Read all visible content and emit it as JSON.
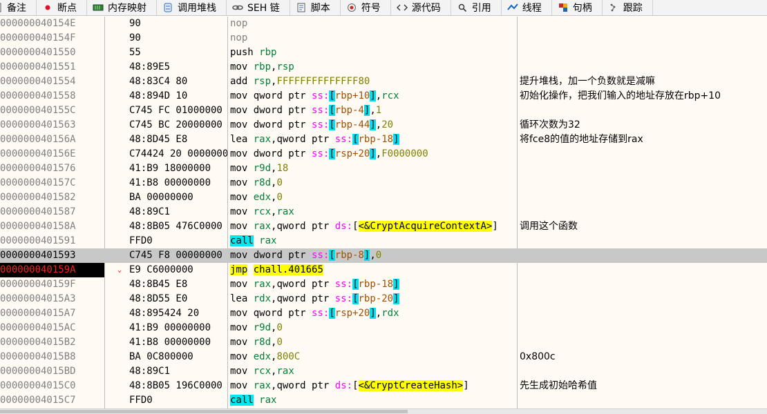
{
  "tabs": [
    {
      "label": "备注",
      "icon": "note-icon"
    },
    {
      "label": "断点",
      "icon": "breakpoint-icon"
    },
    {
      "label": "内存映射",
      "icon": "memory-map-icon"
    },
    {
      "label": "调用堆栈",
      "icon": "call-stack-icon"
    },
    {
      "label": "SEH 链",
      "icon": "seh-chain-icon"
    },
    {
      "label": "脚本",
      "icon": "script-icon"
    },
    {
      "label": "符号",
      "icon": "symbols-icon"
    },
    {
      "label": "源代码",
      "icon": "source-icon"
    },
    {
      "label": "引用",
      "icon": "references-icon"
    },
    {
      "label": "线程",
      "icon": "threads-icon"
    },
    {
      "label": "句柄",
      "icon": "handles-icon"
    },
    {
      "label": "跟踪",
      "icon": "trace-icon"
    }
  ],
  "rows": [
    {
      "addr": "000000040154E",
      "bytes": "90",
      "comment": ""
    },
    {
      "addr": "000000040154F",
      "bytes": "90",
      "comment": ""
    },
    {
      "addr": "0000000401550",
      "bytes": "55",
      "comment": ""
    },
    {
      "addr": "0000000401551",
      "bytes": "48:89E5",
      "comment": ""
    },
    {
      "addr": "0000000401554",
      "bytes": "48:83C4 80",
      "comment": "提升堆栈，加一个负数就是减嘛"
    },
    {
      "addr": "0000000401558",
      "bytes": "48:894D 10",
      "comment": "初始化操作，把我们输入的地址存放在rbp+10"
    },
    {
      "addr": "000000040155C",
      "bytes": "C745 FC 01000000",
      "comment": ""
    },
    {
      "addr": "0000000401563",
      "bytes": "C745 BC 20000000",
      "comment": "循环次数为32"
    },
    {
      "addr": "000000040156A",
      "bytes": "48:8D45 E8",
      "comment": "将fce8的值的地址存储到rax"
    },
    {
      "addr": "000000040156E",
      "bytes": "C74424 20 0000000F",
      "comment": ""
    },
    {
      "addr": "0000000401576",
      "bytes": "41:B9 18000000",
      "comment": ""
    },
    {
      "addr": "000000040157C",
      "bytes": "41:B8 00000000",
      "comment": ""
    },
    {
      "addr": "0000000401582",
      "bytes": "BA 00000000",
      "comment": ""
    },
    {
      "addr": "0000000401587",
      "bytes": "48:89C1",
      "comment": ""
    },
    {
      "addr": "000000040158A",
      "bytes": "48:8B05 476C0000",
      "comment": "调用这个函数"
    },
    {
      "addr": "0000000401591",
      "bytes": "FFD0",
      "comment": ""
    },
    {
      "addr": "0000000401593",
      "bytes": "C745 F8 00000000",
      "comment": ""
    },
    {
      "addr": "000000040159A",
      "bytes": "E9 C6000000",
      "comment": ""
    },
    {
      "addr": "000000040159F",
      "bytes": "48:8B45 E8",
      "comment": ""
    },
    {
      "addr": "00000004015A3",
      "bytes": "48:8D55 E0",
      "comment": ""
    },
    {
      "addr": "00000004015A7",
      "bytes": "48:895424 20",
      "comment": ""
    },
    {
      "addr": "00000004015AC",
      "bytes": "41:B9 00000000",
      "comment": ""
    },
    {
      "addr": "00000004015B2",
      "bytes": "41:B8 00000000",
      "comment": ""
    },
    {
      "addr": "00000004015B8",
      "bytes": "BA 0C800000",
      "comment": "0x800c"
    },
    {
      "addr": "00000004015BD",
      "bytes": "48:89C1",
      "comment": ""
    },
    {
      "addr": "00000004015C0",
      "bytes": "48:8B05 196C0000",
      "comment": "先生成初始哈希值"
    },
    {
      "addr": "00000004015C7",
      "bytes": "FFD0",
      "comment": ""
    }
  ],
  "instructions": {
    "r0": {
      "mnemonic": "nop"
    },
    "r1": {
      "mnemonic": "nop"
    },
    "r2": {
      "mnemonic": "push",
      "op": "rbp"
    },
    "r3": {
      "mnemonic": "mov",
      "op1": "rbp",
      "op2": "rsp"
    },
    "r4": {
      "mnemonic": "add",
      "op1": "rsp",
      "imm": "FFFFFFFFFFFFFF80"
    },
    "r5": {
      "mnemonic": "mov",
      "size": "qword ptr",
      "seg": "ss:",
      "mem": "rbp+10",
      "op2": "rcx"
    },
    "r6": {
      "mnemonic": "mov",
      "size": "dword ptr",
      "seg": "ss:",
      "mem": "rbp-4",
      "imm": "1"
    },
    "r7": {
      "mnemonic": "mov",
      "size": "dword ptr",
      "seg": "ss:",
      "mem": "rbp-44",
      "imm": "20"
    },
    "r8": {
      "mnemonic": "lea",
      "op1": "rax",
      "size": "qword ptr",
      "seg": "ss:",
      "mem": "rbp-18"
    },
    "r9": {
      "mnemonic": "mov",
      "size": "dword ptr",
      "seg": "ss:",
      "mem": "rsp+20",
      "imm": "F0000000"
    },
    "r10": {
      "mnemonic": "mov",
      "op1": "r9d",
      "imm": "18"
    },
    "r11": {
      "mnemonic": "mov",
      "op1": "r8d",
      "imm": "0"
    },
    "r12": {
      "mnemonic": "mov",
      "op1": "edx",
      "imm": "0"
    },
    "r13": {
      "mnemonic": "mov",
      "op1": "rcx",
      "op2": "rax"
    },
    "r14": {
      "mnemonic": "mov",
      "op1": "rax",
      "size": "qword ptr",
      "seg": "ds:",
      "sym": "<&CryptAcquireContextA>"
    },
    "r15": {
      "mnemonic": "call",
      "op": "rax"
    },
    "r16": {
      "mnemonic": "mov",
      "size": "dword ptr",
      "seg": "ss:",
      "mem": "rbp-8",
      "imm": "0"
    },
    "r17": {
      "mnemonic": "jmp",
      "target": "chall.401665"
    },
    "r18": {
      "mnemonic": "mov",
      "op1": "rax",
      "size": "qword ptr",
      "seg": "ss:",
      "mem": "rbp-18"
    },
    "r19": {
      "mnemonic": "lea",
      "op1": "rdx",
      "size": "qword ptr",
      "seg": "ss:",
      "mem": "rbp-20"
    },
    "r20": {
      "mnemonic": "mov",
      "size": "qword ptr",
      "seg": "ss:",
      "mem": "rsp+20",
      "op2": "rdx"
    },
    "r21": {
      "mnemonic": "mov",
      "op1": "r9d",
      "imm": "0"
    },
    "r22": {
      "mnemonic": "mov",
      "op1": "r8d",
      "imm": "0"
    },
    "r23": {
      "mnemonic": "mov",
      "op1": "edx",
      "imm": "800C"
    },
    "r24": {
      "mnemonic": "mov",
      "op1": "rcx",
      "op2": "rax"
    },
    "r25": {
      "mnemonic": "mov",
      "op1": "rax",
      "size": "qword ptr",
      "seg": "ds:",
      "sym": "<&CryptCreateHash>"
    },
    "r26": {
      "mnemonic": "call",
      "op": "rax"
    }
  },
  "state": {
    "selected_row": 16,
    "eip_row": 17,
    "jump_marker": "⌄"
  },
  "colors": {
    "background": "#fffaf4",
    "selected": "#c8c8c8",
    "eip_bg": "#000000",
    "eip_fg": "#ff1c1c",
    "call_hl": "#00e8f0",
    "jmp_hl": "#ffff00",
    "register": "#00803a",
    "segment": "#ff00ff"
  }
}
